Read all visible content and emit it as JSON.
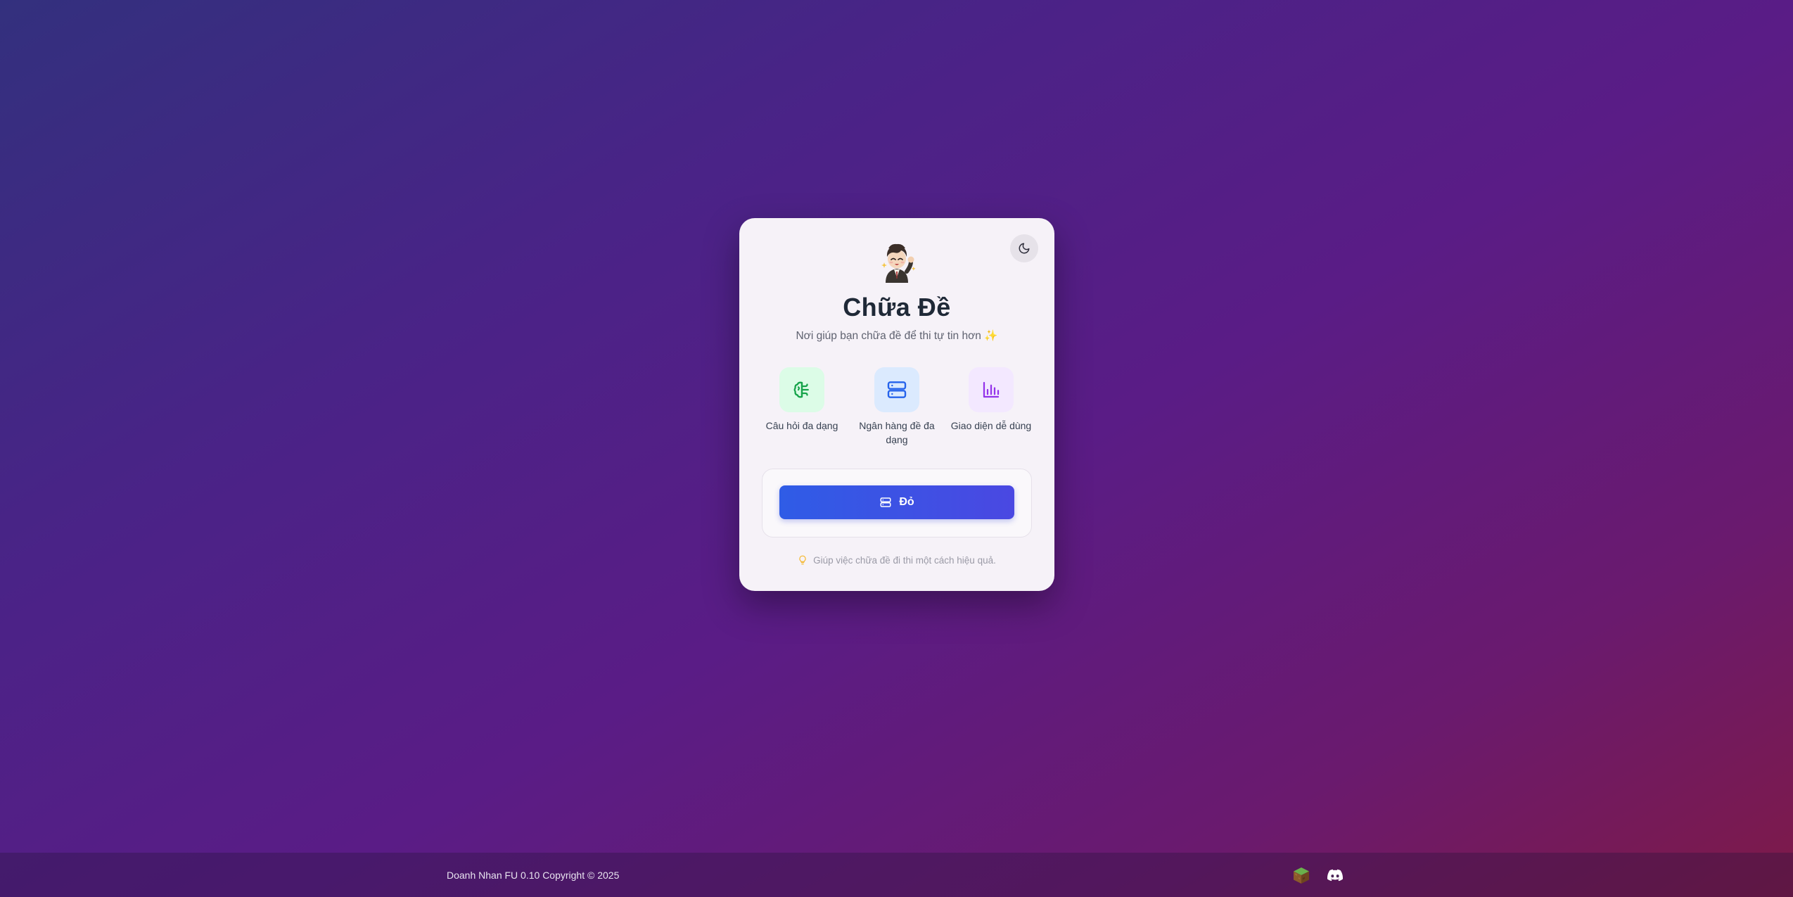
{
  "card": {
    "title": "Chữa Đề",
    "subtitle": "Nơi giúp bạn chữa đề để thi tự tin hơn ✨",
    "features": [
      {
        "label": "Câu hỏi đa dạng",
        "icon": "brain-icon",
        "color": "#16a34a",
        "bg": "#dcfce7"
      },
      {
        "label": "Ngân hàng đề đa dạng",
        "icon": "server-icon",
        "color": "#2563eb",
        "bg": "#dbeafe"
      },
      {
        "label": "Giao diện dễ dùng",
        "icon": "bar-chart-icon",
        "color": "#9333ea",
        "bg": "#f3e8ff"
      }
    ],
    "main_button": {
      "label": "Đỏ",
      "icon": "server-icon"
    },
    "tip": "Giúp việc chữa đề đi thi một cách hiệu quả.",
    "theme_toggle_icon": "moon-icon",
    "avatar": "businessman-avatar"
  },
  "footer": {
    "copyright": "Doanh Nhan FU 0.10 Copyright © 2025",
    "icons": [
      "minecraft-block-icon",
      "discord-icon"
    ]
  },
  "colors": {
    "accent": "#3b5ce6",
    "title": "#1f2937",
    "card_bg": "#f6f2f8"
  }
}
